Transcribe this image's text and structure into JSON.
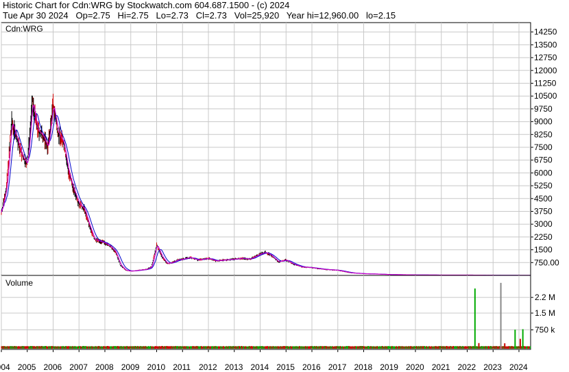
{
  "header": {
    "line1": "Historic Chart for Cdn:WRG by Stockwatch.com 604.687.1500 - (c) 2024",
    "line2": "Tue Apr 30 2024   Op=2.75   Hi=2.75   Lo=2.73   Cl=2.73   Vol=25,920   Year hi=12,960.00   lo=2.15"
  },
  "colors": {
    "price_bar": "#000000",
    "down_bar": "#cc0000",
    "ma_short": "#cc00cc",
    "ma_long": "#0000cc",
    "vol_up": "#00aa00",
    "vol_down": "#cc0000",
    "vol_neutral": "#888888",
    "grid": "#c8c8c8"
  },
  "chart_data": [
    {
      "type": "line",
      "title": "Cdn:WRG",
      "xlabel": "",
      "ylabel": "",
      "grid": true,
      "ylim": [
        0,
        14800
      ],
      "yticks": [
        14250,
        13500,
        12750,
        12000,
        11250,
        10500,
        9750,
        9000,
        8250,
        7500,
        6750,
        6000,
        5250,
        4500,
        3750,
        3000,
        2250,
        1500,
        "750.00"
      ],
      "xticks": [
        "2004",
        "2005",
        "2006",
        "2007",
        "2008",
        "2009",
        "2010",
        "2011",
        "2012",
        "2013",
        "2014",
        "2015",
        "2016",
        "2017",
        "2018",
        "2019",
        "2020",
        "2021",
        "2022",
        "2023",
        "2024"
      ],
      "x": [
        2004.0,
        2004.2,
        2004.4,
        2004.6,
        2004.8,
        2005.0,
        2005.2,
        2005.4,
        2005.6,
        2005.8,
        2006.0,
        2006.2,
        2006.4,
        2006.6,
        2006.8,
        2007.0,
        2007.2,
        2007.4,
        2007.6,
        2007.8,
        2008.0,
        2008.2,
        2008.4,
        2008.6,
        2008.8,
        2009.0,
        2009.2,
        2009.4,
        2009.6,
        2009.8,
        2010.0,
        2010.2,
        2010.4,
        2010.6,
        2010.8,
        2011.0,
        2011.3,
        2011.6,
        2012.0,
        2012.3,
        2012.6,
        2013.0,
        2013.3,
        2013.6,
        2014.0,
        2014.2,
        2014.4,
        2014.7,
        2015.0,
        2015.3,
        2015.6,
        2016.0,
        2016.5,
        2017.0,
        2017.5,
        2018.0,
        2018.5,
        2019.0,
        2020.0,
        2021.0,
        2022.0,
        2022.5,
        2023.0,
        2023.5,
        2024.0,
        2024.33
      ],
      "series": [
        {
          "values": [
            3700,
            5200,
            9000,
            8000,
            7000,
            6500,
            10200,
            8500,
            8200,
            7500,
            10000,
            8300,
            7800,
            6000,
            5000,
            4200,
            3900,
            2900,
            2100,
            2000,
            1900,
            1700,
            1400,
            600,
            300,
            250,
            280,
            320,
            350,
            500,
            1800,
            1100,
            700,
            750,
            900,
            950,
            1050,
            900,
            1000,
            850,
            900,
            950,
            1000,
            950,
            1250,
            1350,
            1200,
            800,
            900,
            650,
            500,
            450,
            350,
            300,
            150,
            100,
            80,
            50,
            30,
            20,
            20,
            15,
            10,
            8,
            5,
            2.73
          ]
        }
      ]
    },
    {
      "type": "bar",
      "title": "Volume",
      "ylim": [
        0,
        3000000
      ],
      "yticks": [
        "2.2 M",
        "1.5 M",
        "750 k"
      ],
      "bars": [
        {
          "x": 2022.3,
          "value": 2600000
        },
        {
          "x": 2022.45,
          "value": 160000
        },
        {
          "x": 2023.3,
          "value": 2850000
        },
        {
          "x": 2023.45,
          "value": 150000
        },
        {
          "x": 2023.85,
          "value": 760000
        },
        {
          "x": 2024.05,
          "value": 350000
        },
        {
          "x": 2024.15,
          "value": 780000
        }
      ]
    }
  ]
}
